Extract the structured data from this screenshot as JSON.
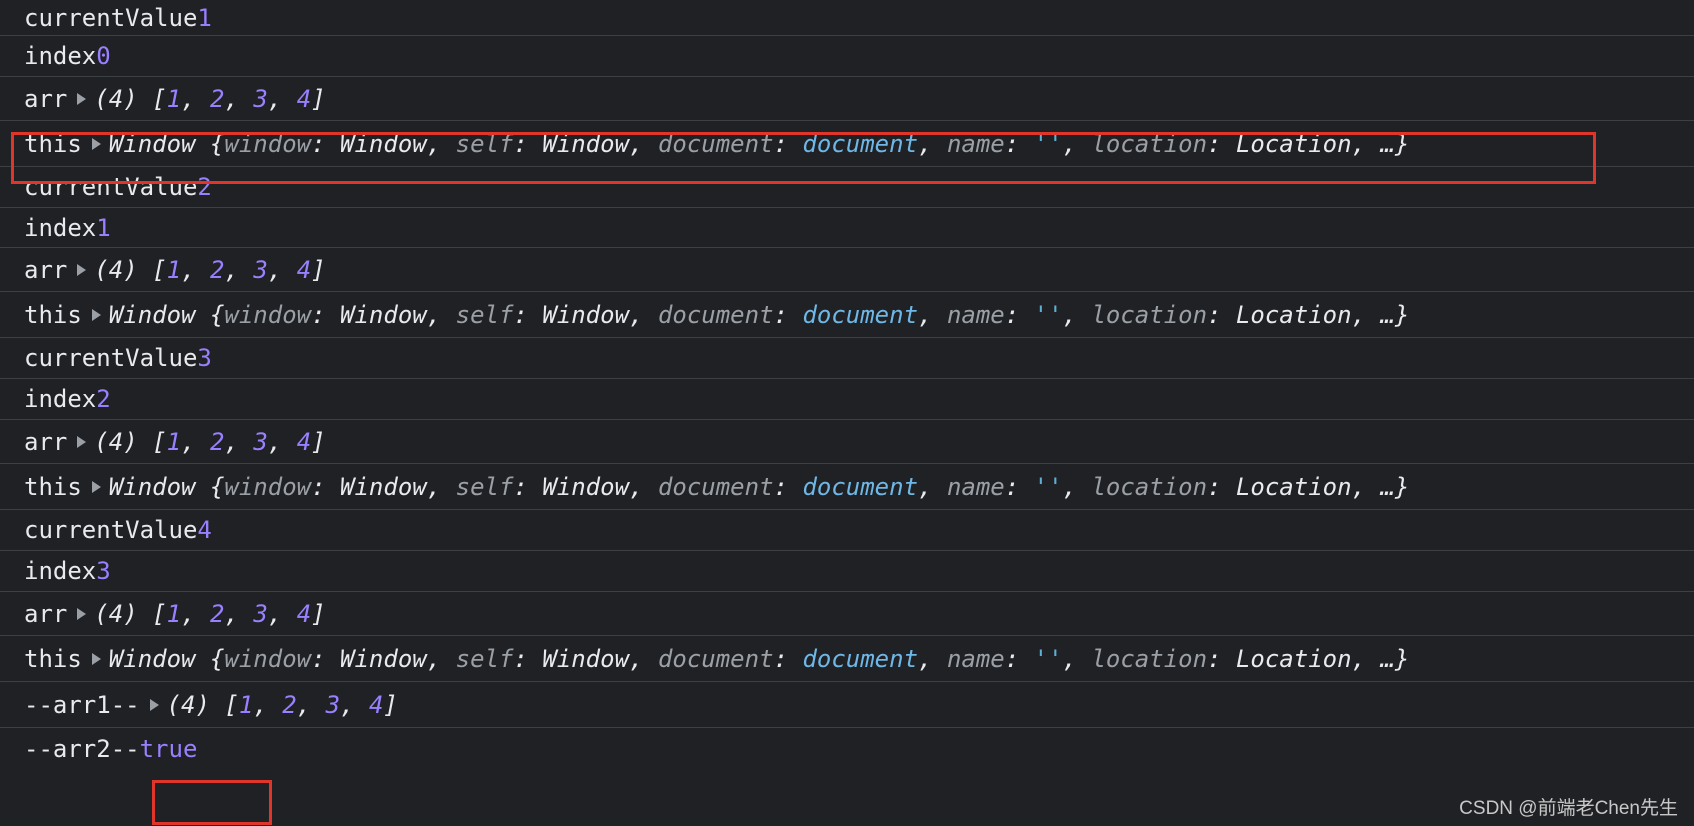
{
  "console": {
    "logs": [
      {
        "label": "currentValue",
        "value": "1"
      },
      {
        "label": "index",
        "value": "0"
      },
      {
        "label": "arr",
        "arr_len": "(4)",
        "arr": [
          "1",
          "2",
          "3",
          "4"
        ]
      },
      {
        "label": "this"
      },
      {
        "label": "currentValue",
        "value": "2"
      },
      {
        "label": "index",
        "value": "1"
      },
      {
        "label": "arr",
        "arr_len": "(4)",
        "arr": [
          "1",
          "2",
          "3",
          "4"
        ]
      },
      {
        "label": "this"
      },
      {
        "label": "currentValue",
        "value": "3"
      },
      {
        "label": "index",
        "value": "2"
      },
      {
        "label": "arr",
        "arr_len": "(4)",
        "arr": [
          "1",
          "2",
          "3",
          "4"
        ]
      },
      {
        "label": "this"
      },
      {
        "label": "currentValue",
        "value": "4"
      },
      {
        "label": "index",
        "value": "3"
      },
      {
        "label": "arr",
        "arr_len": "(4)",
        "arr": [
          "1",
          "2",
          "3",
          "4"
        ]
      },
      {
        "label": "this"
      },
      {
        "label": "--arr1--",
        "arr_len": "(4)",
        "arr": [
          "1",
          "2",
          "3",
          "4"
        ]
      },
      {
        "label": "--arr2--",
        "value": "true"
      }
    ],
    "window_object": {
      "class": "Window",
      "props": [
        {
          "key": "window",
          "val": "Window"
        },
        {
          "key": "self",
          "val": "Window"
        },
        {
          "key": "document",
          "val": "document"
        },
        {
          "key": "name",
          "val": "''"
        },
        {
          "key": "location",
          "val": "Location"
        }
      ],
      "ellipsis": "…"
    }
  },
  "watermark": "CSDN @前端老Chen先生",
  "colors": {
    "background": "#202124",
    "number": "#9980ff",
    "highlight_box": "#e0352b"
  }
}
